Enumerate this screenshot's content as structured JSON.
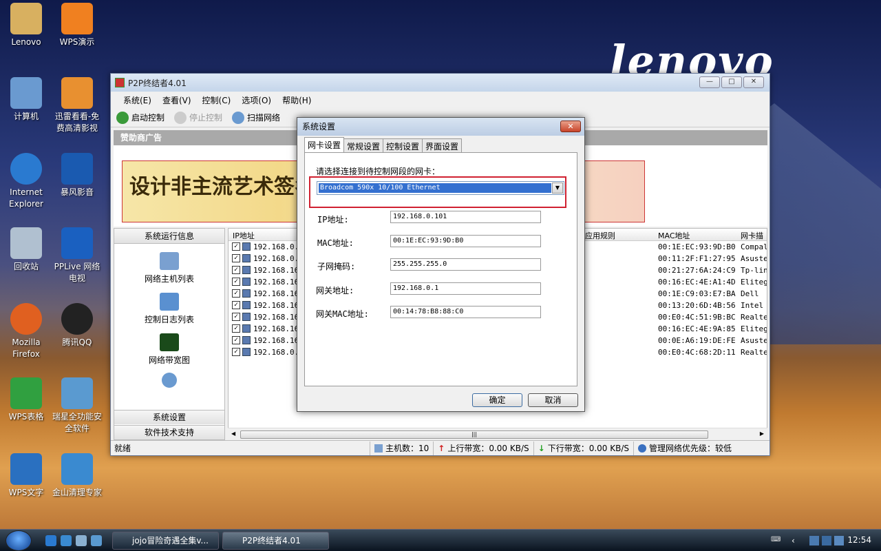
{
  "desktop": {
    "logo": "lenovo",
    "icons": [
      {
        "label": "Lenovo"
      },
      {
        "label": "WPS演示"
      },
      {
        "label": "计算机"
      },
      {
        "label": "迅雷看看-免费高清影视"
      },
      {
        "label": "Internet Explorer"
      },
      {
        "label": "暴风影音"
      },
      {
        "label": "回收站"
      },
      {
        "label": "PPLive 网络电视"
      },
      {
        "label": "Mozilla Firefox"
      },
      {
        "label": "腾讯QQ"
      },
      {
        "label": "WPS表格"
      },
      {
        "label": "瑞星全功能安全软件"
      },
      {
        "label": "WPS文字"
      },
      {
        "label": "金山清理专家"
      }
    ]
  },
  "window": {
    "title": "P2P终结者4.01",
    "menu": [
      "系统(E)",
      "查看(V)",
      "控制(C)",
      "选项(O)",
      "帮助(H)"
    ],
    "toolbar": {
      "start": "启动控制",
      "stop": "停止控制",
      "scan": "扫描网络"
    },
    "sponsor": "赞助商广告",
    "banner_text": "设计非主流艺术签名",
    "left_panel": {
      "header": "系统运行信息",
      "items": [
        "网络主机列表",
        "控制日志列表",
        "网络带宽图",
        "系统设置"
      ],
      "footer": "软件技术支持"
    },
    "table": {
      "headers": {
        "ip": "IP地址",
        "rule": "应用规则",
        "mac": "MAC地址",
        "nic": "网卡描"
      },
      "rows": [
        {
          "ip": "192.168.0.1",
          "mac": "00:1E:EC:93:9D:B0",
          "nic": "Compal"
        },
        {
          "ip": "192.168.0.1",
          "mac": "00:11:2F:F1:27:95",
          "nic": "Asustel"
        },
        {
          "ip": "192.168.16.",
          "mac": "00:21:27:6A:24:C9",
          "nic": "Tp-lin"
        },
        {
          "ip": "192.168.16.",
          "mac": "00:16:EC:4E:A1:4D",
          "nic": "Elitegr"
        },
        {
          "ip": "192.168.16.",
          "mac": "00:1E:C9:03:E7:BA",
          "nic": "Dell"
        },
        {
          "ip": "192.168.16.",
          "mac": "00:13:20:6D:4B:56",
          "nic": "Intel ("
        },
        {
          "ip": "192.168.16.",
          "mac": "00:E0:4C:51:9B:BC",
          "nic": "Realtel"
        },
        {
          "ip": "192.168.16.",
          "mac": "00:16:EC:4E:9A:85",
          "nic": "Elitegr"
        },
        {
          "ip": "192.168.16.",
          "mac": "00:0E:A6:19:DE:FE",
          "nic": "Asustel"
        },
        {
          "ip": "192.168.0.1",
          "mac": "00:E0:4C:68:2D:11",
          "nic": "Realtel"
        }
      ]
    },
    "status": {
      "ready": "就绪",
      "hosts": "主机数：10",
      "up": "上行带宽：0.00 KB/S",
      "down": "下行带宽：0.00 KB/S",
      "priority": "管理网络优先级：较低"
    }
  },
  "dialog": {
    "title": "系统设置",
    "tabs": [
      "网卡设置",
      "常规设置",
      "控制设置",
      "界面设置"
    ],
    "prompt": "请选择连接到待控制网段的网卡：",
    "adapter": "Broadcom 590x 10/100 Ethernet",
    "fields": [
      {
        "label": "IP地址:",
        "value": "192.168.0.101"
      },
      {
        "label": "MAC地址:",
        "value": "00:1E:EC:93:9D:B0"
      },
      {
        "label": "子网掩码:",
        "value": "255.255.255.0"
      },
      {
        "label": "网关地址:",
        "value": "192.168.0.1"
      },
      {
        "label": "网关MAC地址:",
        "value": "00:14:78:B8:88:C0"
      }
    ],
    "ok": "确定",
    "cancel": "取消"
  },
  "taskbar": {
    "tasks": [
      "jojo冒险奇遇全集v...",
      "P2P终结者4.01"
    ],
    "clock": "12:54"
  }
}
